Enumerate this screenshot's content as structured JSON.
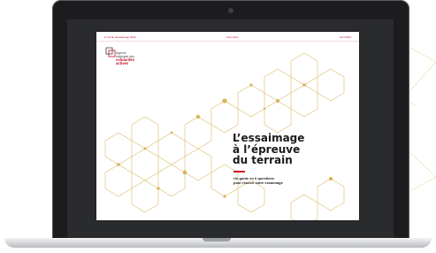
{
  "doc": {
    "header": {
      "left": "le Guide dessaimage 2024",
      "mid": "Sommaire",
      "right": "Avril 2024"
    },
    "logo": {
      "line1": "Agence",
      "line2": "nationale des",
      "line3": "solidarités",
      "line4": "actives"
    },
    "title": "L’essaimage\nà l’épreuve\ndu terrain",
    "subtitle": "Un guide en 6 questions\npour réussir votre essaimage"
  },
  "colors": {
    "accent": "#c8102e",
    "hex_gold": "#d8b35a"
  }
}
